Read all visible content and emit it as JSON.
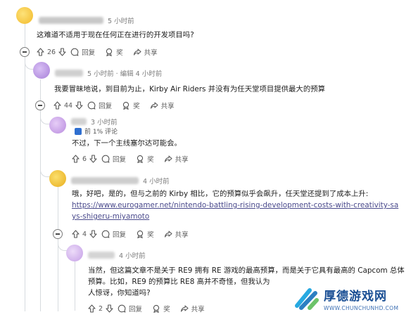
{
  "comments": [
    {
      "id": "c1",
      "time": "5 小时前",
      "text": "这难道不适用于现在任何正在进行的开发项目吗?",
      "votes": "26",
      "reply_label": "回复",
      "award_label": "奖",
      "share_label": "共享",
      "avatar_color": "#f5c343"
    },
    {
      "id": "c2",
      "time": "5 小时前 · 编辑 4 小时前",
      "text": "我要冒昧地说，到目前为止，Kirby Air Riders 并没有为任天堂项目提供最大的预算",
      "votes": "44",
      "reply_label": "回复",
      "award_label": "奖",
      "share_label": "共享",
      "avatar_color": "#b894e0"
    },
    {
      "id": "c3",
      "time": "3 小时前",
      "flair": "前 1% 评论",
      "text": "不过，下一个主线塞尔达可能会。",
      "votes": "6",
      "reply_label": "回复",
      "award_label": "奖",
      "share_label": "共享",
      "avatar_color": "#c9a0e6"
    },
    {
      "id": "c4",
      "time": "4 小时前",
      "text": "哦，好吧，是的，但与之前的 Kirby 相比，它的预算似乎会飙升，任天堂还提到了成本上升:",
      "link": "https://www.eurogamer.net/nintendo-battling-rising-development-costs-with-creativity-says-shigeru-miyamoto",
      "votes": "4",
      "reply_label": "回复",
      "award_label": "奖",
      "share_label": "共享",
      "avatar_color": "#f2c23a"
    },
    {
      "id": "c5",
      "time": "4 小时前",
      "text": "当然，但这篇文章不是关于 RE9 拥有 RE 游戏的最高预算，而是关于它具有最高的 Capcom 总体预算。比如，RE9 的预算比 RE8 高并不奇怪，但我认为",
      "text_end": "人惊讶，你知道吗?",
      "votes": "2",
      "reply_label": "回复",
      "award_label": "奖",
      "share_label": "共享",
      "avatar_color": "#d5b3ee"
    }
  ],
  "watermark": {
    "title": "厚德游戏网",
    "url": "WWW.CHUNCHUNHD.COM"
  },
  "icons": [
    "collapse-icon",
    "upvote-icon",
    "downvote-icon",
    "comment-icon",
    "award-icon",
    "share-icon",
    "more-icon"
  ]
}
